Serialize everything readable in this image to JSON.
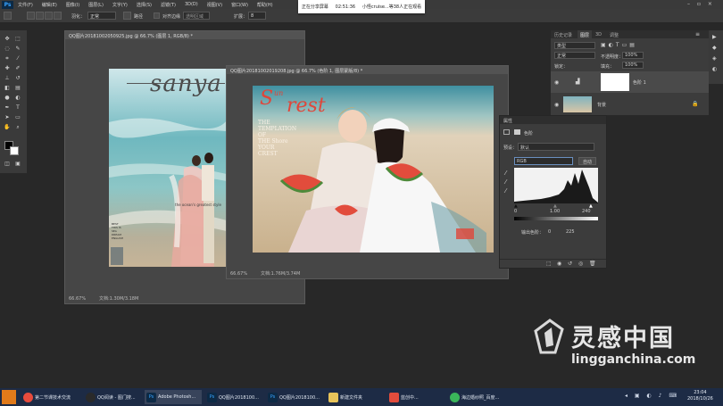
{
  "menubar": {
    "app_icon": "Ps",
    "items": [
      "文件(F)",
      "编辑(E)",
      "图像(I)",
      "图层(L)",
      "文字(Y)",
      "选择(S)",
      "滤镜(T)",
      "3D(D)",
      "视图(V)",
      "窗口(W)",
      "帮助(H)"
    ]
  },
  "options": {
    "mode_label": "模式：",
    "mode_value": "正常",
    "opacity_label": "不透明度：",
    "opacity_value": "100%",
    "reverse_label": "反向",
    "dither_label": "仿色",
    "transparency_label": "透明区域",
    "left_fields": [
      "羽化：",
      "正常",
      "路径",
      "对齐边缘"
    ],
    "zoom_label": "扩展：",
    "zoom_value": "8"
  },
  "banner": {
    "sharing": "正在分享屏幕",
    "time": "02:51:36",
    "viewers": "小怪cruise...等38人正在观看"
  },
  "doc1": {
    "title": "QQ图片20181002050925.jpg @ 66.7% (图层 1, RGB/8) *",
    "zoom": "66.67%",
    "docsize": "文档:1.30M/3.18M",
    "photo": {
      "headline": "sanya",
      "caption": "the ocean's greatest style",
      "small_text": [
        "BEST",
        "THIS IS",
        "SEA",
        "DREAM",
        "ENGLISH"
      ]
    }
  },
  "doc2": {
    "title": "QQ图片20181002019208.jpg @ 66.7% (色阶 1, 图层蒙版/8) *",
    "zoom": "66.67%",
    "docsize": "文档:1.76M/3.74M",
    "photo": {
      "headline_s": "S",
      "headline_un": "un",
      "headline_rest": "rest",
      "lines": [
        "THE",
        "TEMPLATION",
        "OF",
        "THE  Shore",
        "YOUR",
        "CREST"
      ]
    }
  },
  "properties": {
    "tab": "属性",
    "header": "色阶",
    "preset_label": "预设：",
    "preset_value": "默认",
    "channel_value": "RGB",
    "auto_button": "自动",
    "input_values": [
      "0",
      "1.00",
      "240"
    ],
    "output_label": "输出色阶：",
    "output_values": [
      "0",
      "225"
    ]
  },
  "layers_panel": {
    "tabs": [
      "历史记录",
      "图层",
      "3D",
      "调整"
    ],
    "active_tab": "图层",
    "kind_label": "类型",
    "blend_mode": "正常",
    "opacity_label": "不透明度：",
    "opacity_value": "100%",
    "lock_label": "锁定：",
    "fill_label": "填充：",
    "fill_value": "100%",
    "layers": [
      {
        "name": "色阶 1"
      },
      {
        "name": "背景"
      }
    ]
  },
  "taskbar": {
    "tasks": [
      "第二节课技术交流",
      "QQ阅读 - 图门搜...",
      "Adobe Photosh...",
      "QQ图片2018100...",
      "QQ图片2018100...",
      "新建文件夹",
      "蓝创中...",
      "海边婚纱照_百度..."
    ],
    "clock_time": "23:04",
    "clock_date": "2018/10/26"
  },
  "watermark": {
    "brand": "灵感中国",
    "url": "lingganchina.com"
  },
  "colors": {
    "app_bg": "#282828",
    "panel": "#3c3c3c",
    "taskbar": "#1d2b45",
    "accent_red": "#e0463a",
    "ps_blue": "#36a3ff"
  }
}
